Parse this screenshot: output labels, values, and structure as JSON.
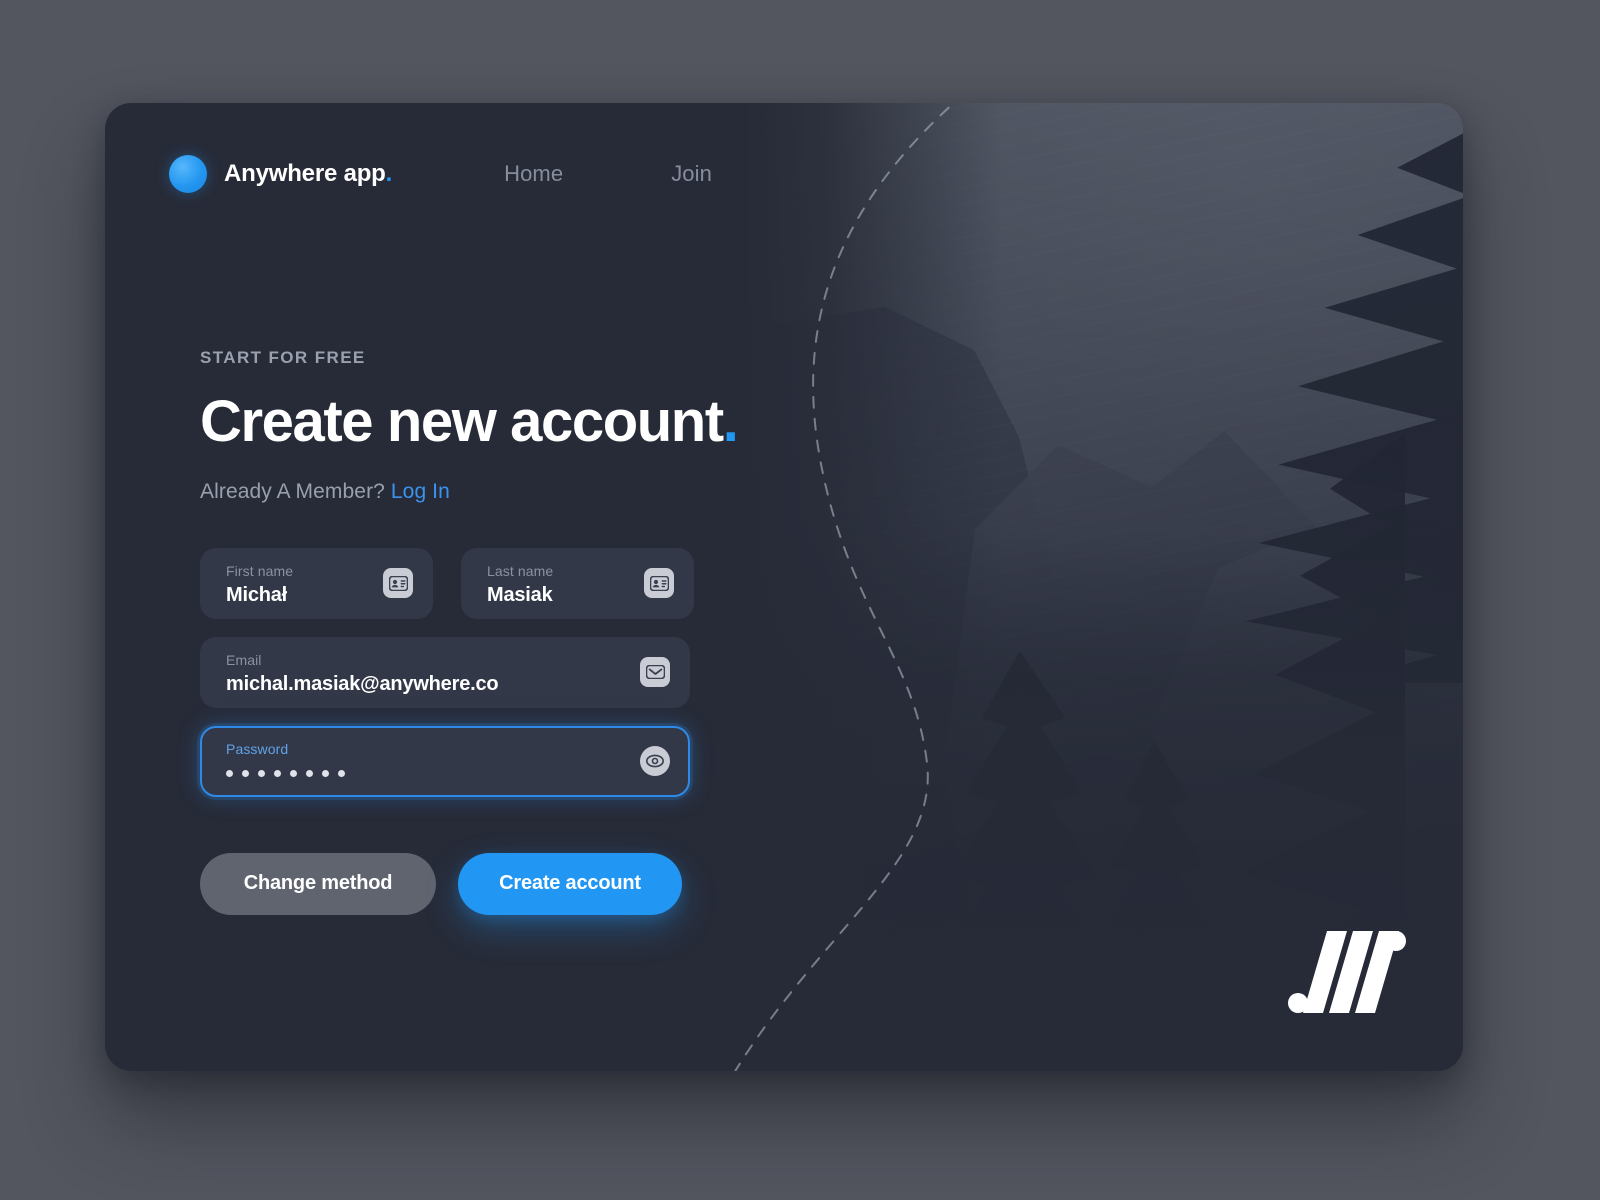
{
  "brand": {
    "name": "Anywhere app",
    "name_dot": ".",
    "mark_icon": "blue-circle-logo-icon"
  },
  "nav": {
    "items": [
      {
        "label": "Home",
        "name": "home"
      },
      {
        "label": "Join",
        "name": "join"
      }
    ]
  },
  "hero": {
    "eyebrow": "START FOR FREE",
    "headline": "Create new account",
    "headline_dot": ".",
    "member_prompt": "Already A Member?",
    "login_link": "Log In"
  },
  "form": {
    "first_name": {
      "label": "First name",
      "value": "Michał",
      "icon": "contact-card-icon"
    },
    "last_name": {
      "label": "Last name",
      "value": "Masiak",
      "icon": "contact-card-icon"
    },
    "email": {
      "label": "Email",
      "value": "michal.masiak@anywhere.co",
      "icon": "envelope-icon"
    },
    "password": {
      "label": "Password",
      "value": "••••••••",
      "dot_count": 8,
      "icon": "eye-icon",
      "focused": true
    }
  },
  "actions": {
    "secondary_label": "Change method",
    "primary_label": "Create account"
  },
  "watermark": {
    "name": "anywhere-monogram-logo"
  },
  "colors": {
    "page_background": "#53565f",
    "card_background": "#272b38",
    "field_background": "#333848",
    "accent_blue": "#2196f3",
    "focus_border": "#2e8ae6",
    "muted_text": "#8a91a0",
    "secondary_button": "#5f646f",
    "white": "#ffffff"
  }
}
